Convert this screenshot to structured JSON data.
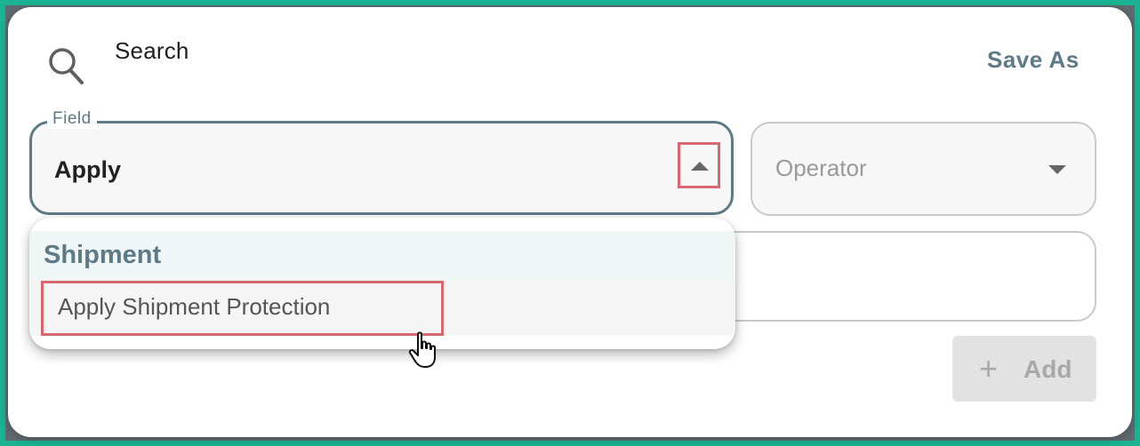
{
  "dialog": {
    "title": "Search",
    "save_as_label": "Save As"
  },
  "field": {
    "label": "Field",
    "value": "Apply",
    "toggle_icon": "arrow-up-icon"
  },
  "operator": {
    "placeholder": "Operator",
    "caret_icon": "chevron-down-icon"
  },
  "dropdown": {
    "group_label": "Shipment",
    "options": [
      {
        "label": "Apply Shipment Protection"
      }
    ]
  },
  "add_button": {
    "label": "Add",
    "icon": "plus-icon"
  },
  "colors": {
    "accent": "#5d7a86",
    "highlight": "#d9676f",
    "frame": "#1ab394"
  }
}
